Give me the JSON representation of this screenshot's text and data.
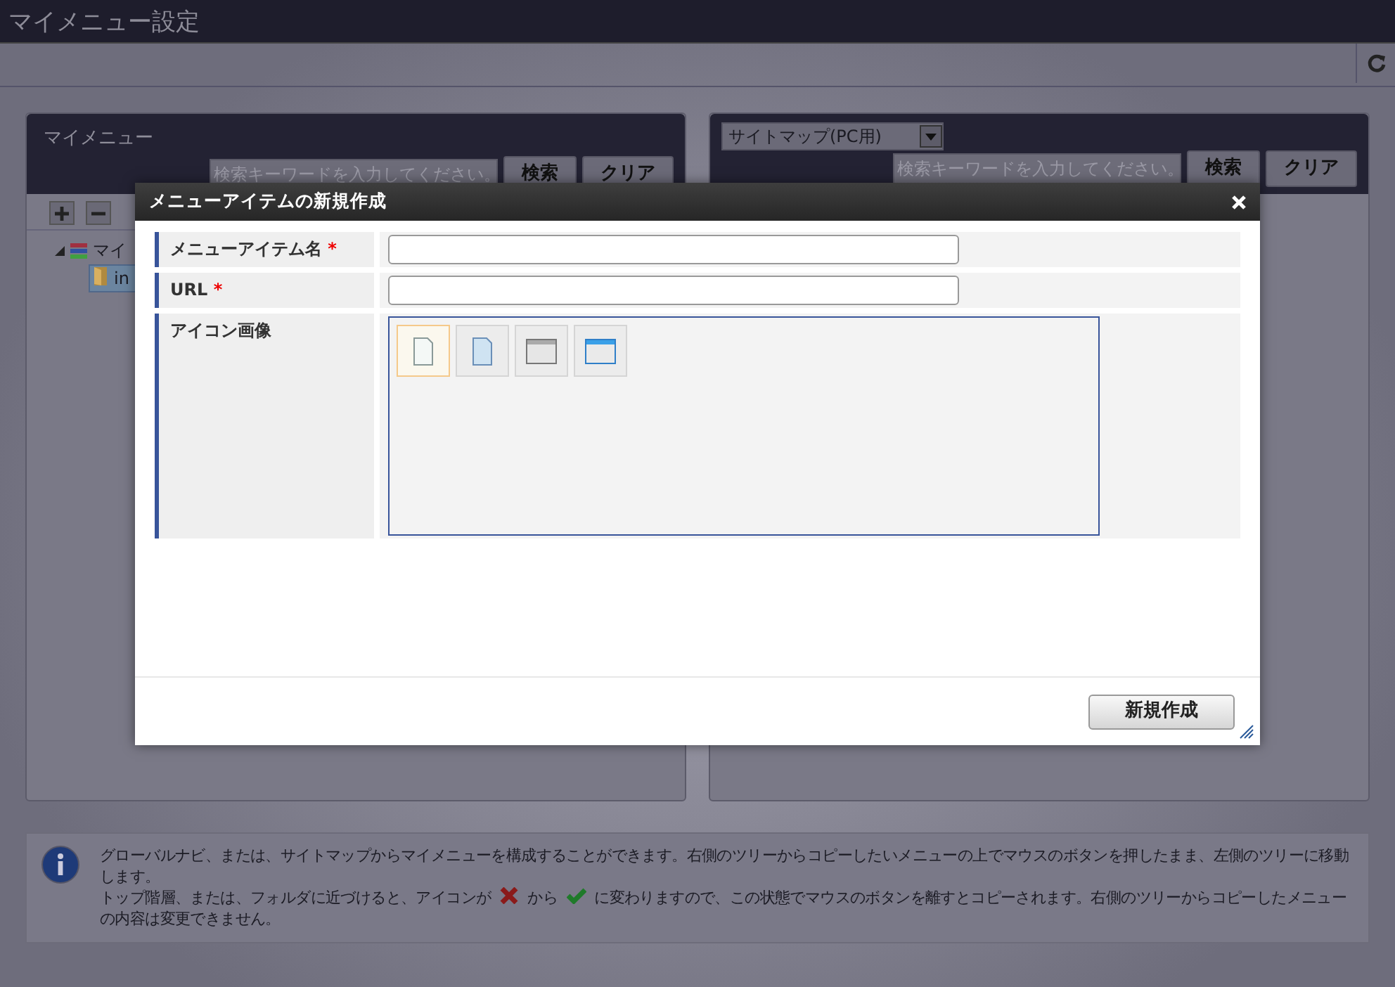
{
  "window": {
    "title": "マイメニュー設定"
  },
  "left_panel": {
    "title": "マイメニュー",
    "search": {
      "placeholder": "検索キーワードを入力してください。"
    },
    "buttons": [
      "検索",
      "クリア"
    ],
    "tree": [
      {
        "label": "マイ",
        "expanded": true,
        "children": [
          {
            "label": "in",
            "selected": true
          }
        ]
      }
    ]
  },
  "right_panel": {
    "dropdown": "サイトマップ(PC用)",
    "search": {
      "placeholder": "検索キーワードを入力してください。"
    },
    "buttons": [
      "検索",
      "クリア"
    ]
  },
  "dialog": {
    "title": "メニューアイテムの新規作成",
    "fields": [
      {
        "label": "メニューアイテム名",
        "required": true,
        "required_mark": "*",
        "kind": "text"
      },
      {
        "label": "URL",
        "required": true,
        "required_mark": "*",
        "kind": "text"
      },
      {
        "label": "アイコン画像",
        "required": false,
        "kind": "icons"
      }
    ],
    "icons": [
      {
        "kind": "page",
        "selected": true
      },
      {
        "kind": "page-blue",
        "selected": false
      },
      {
        "kind": "window",
        "selected": false
      },
      {
        "kind": "window-blue",
        "selected": false
      }
    ],
    "button": "新規作成"
  },
  "info": {
    "line_1": "グローバルナビ、または、サイトマップからマイメニューを構成することができます。右側のツリーからコピーしたいメニューの上でマウスのボタンを押したまま、左側のツリーに移動します。",
    "line_2_before": "トップ階層、または、フォルダに近づけると、アイコンが",
    "line_2_middle": "から",
    "line_2_after": "に変わりますので、この状態でマウスのボタンを離すとコピーされます。右側のツリーからコピーしたメニュー",
    "line_3": "の内容は変更できません。"
  }
}
